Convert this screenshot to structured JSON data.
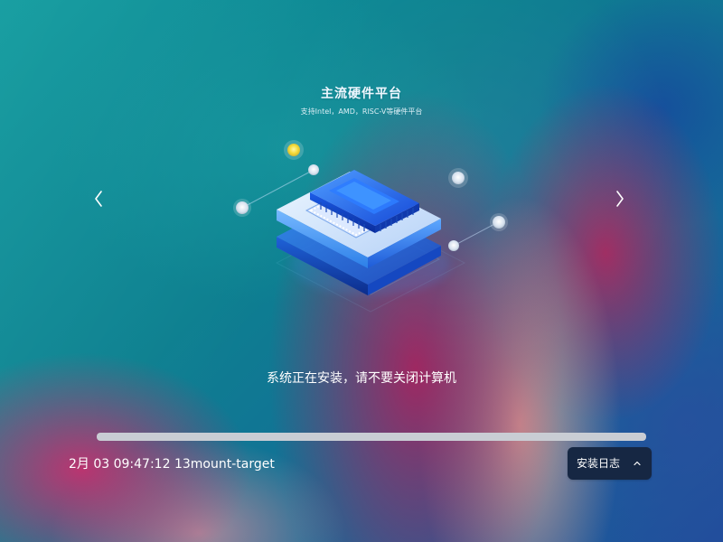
{
  "slide": {
    "title": "主流硬件平台",
    "subtitle": "支持Intel，AMD，RISC-V等硬件平台"
  },
  "install": {
    "status_text": "系统正在安装，请不要关闭计算机",
    "progress_fraction": 1.0,
    "log_line": "2月 03 09:47:12 13mount-target"
  },
  "controls": {
    "log_button_label": "安装日志"
  },
  "icons": {
    "left_nav": "chevron-left-icon",
    "right_nav": "chevron-right-icon",
    "log_toggle": "chevron-up-icon"
  },
  "colors": {
    "button_bg": "#162743",
    "progress_fill": "#c9cdd4",
    "text_primary": "#ffffff"
  }
}
